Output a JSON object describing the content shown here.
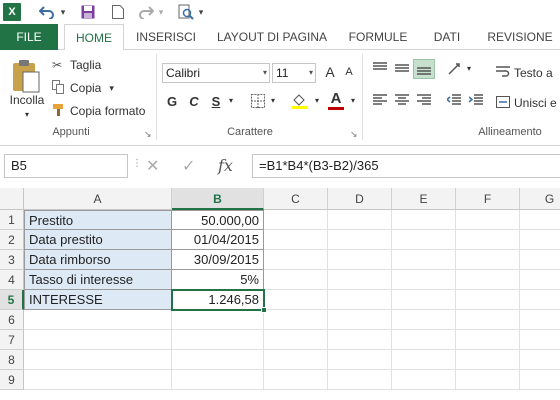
{
  "qat": {
    "logo_letter": "X",
    "undo_icon": "undo-icon",
    "save_icon": "save-icon",
    "new_icon": "new-icon",
    "redo_icon": "redo-icon",
    "preview_icon": "print-preview-icon",
    "dropdown_glyph": "▾"
  },
  "tabs": [
    "FILE",
    "HOME",
    "INSERISCI",
    "LAYOUT DI PAGINA",
    "FORMULE",
    "DATI",
    "REVISIONE"
  ],
  "ribbon": {
    "clipboard": {
      "paste_label": "Incolla",
      "cut_label": "Taglia",
      "copy_label": "Copia",
      "format_painter_label": "Copia formato",
      "group_label": "Appunti"
    },
    "font": {
      "font_name": "Calibri",
      "font_size": "11",
      "grow_glyph": "A",
      "shrink_glyph": "A",
      "bold": "G",
      "italic": "C",
      "underline": "S",
      "font_color_glyph": "A",
      "group_label": "Carattere"
    },
    "alignment": {
      "wrap_label": "Testo a",
      "merge_label": "Unisci e",
      "group_label": "Allineamento"
    }
  },
  "formula_bar": {
    "name_box": "B5",
    "cancel_glyph": "✕",
    "enter_glyph": "✓",
    "fx_label": "fx",
    "formula": "=B1*B4*(B3-B2)/365"
  },
  "sheet": {
    "columns": [
      "A",
      "B",
      "C",
      "D",
      "E",
      "F",
      "G"
    ],
    "selected_column": "B",
    "rows": [
      "1",
      "2",
      "3",
      "4",
      "5",
      "6",
      "7",
      "8",
      "9"
    ],
    "selected_row": "5",
    "cells": [
      {
        "label": "Prestito",
        "value": "50.000,00"
      },
      {
        "label": "Data prestito",
        "value": "01/04/2015"
      },
      {
        "label": "Data rimborso",
        "value": "30/09/2015"
      },
      {
        "label": "Tasso di interesse",
        "value": "5%"
      },
      {
        "label": "INTERESSE",
        "value": "1.246,58"
      }
    ]
  },
  "colors": {
    "accent": "#217346",
    "label_fill": "#dde9f5",
    "font_color_bar": "#c00000"
  }
}
